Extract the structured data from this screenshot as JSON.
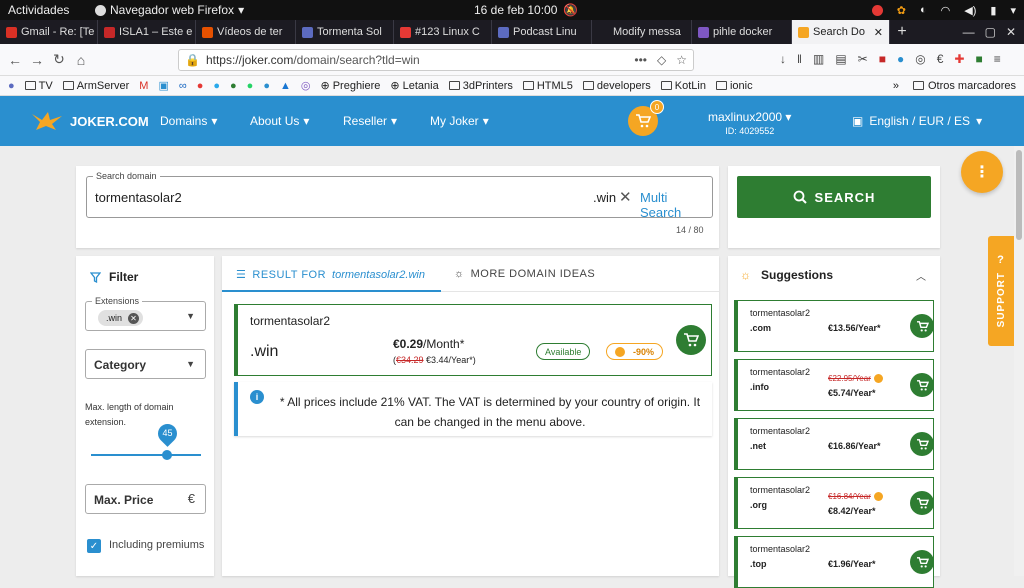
{
  "os": {
    "activities": "Actividades",
    "app_name": "Navegador web Firefox",
    "clock": "16 de feb  10:00"
  },
  "tabs": [
    {
      "label": "Gmail - Re: [Te",
      "color": "#d93025"
    },
    {
      "label": "ISLA1 – Este e",
      "color": "#c62828"
    },
    {
      "label": "Vídeos de ter",
      "color": "#e65100"
    },
    {
      "label": "Tormenta Sol",
      "color": "#5c6bc0"
    },
    {
      "label": "#123 Linux C",
      "color": "#e53935"
    },
    {
      "label": "Podcast Linu",
      "color": "#5c6bc0"
    },
    {
      "label": "Modify messa",
      "color": "#555555"
    },
    {
      "label": "pihle docker",
      "color": "#7e57c2"
    },
    {
      "label": "Search Do",
      "color": "#f5a623",
      "active": true
    }
  ],
  "url": {
    "host": "https://joker.com",
    "path": "/domain/search?tld=win"
  },
  "bookmarks": [
    "TV",
    "ArmServer",
    "Preghiere",
    "Letania",
    "3dPrinters",
    "HTML5",
    "developers",
    "KotLin",
    "ionic"
  ],
  "bookmarks_other": "Otros marcadores",
  "joker": {
    "logo": "JOKER.COM",
    "nav": [
      "Domains",
      "About Us",
      "Reseller",
      "My Joker"
    ],
    "cart_count": "0",
    "user": "maxlinux2000",
    "user_id": "ID: 4029552",
    "lang": "English / EUR / ES",
    "accent": "#2a8fcf",
    "orange": "#f5a623",
    "green": "#2e7d32"
  },
  "search": {
    "label": "Search domain",
    "value": "tormentasolar2",
    "tld": ".win",
    "multi": "Multi Search",
    "count": "14 / 80",
    "button": "SEARCH"
  },
  "support": "SUPPORT",
  "filter": {
    "title": "Filter",
    "ext_label": "Extensions",
    "ext_chip": ".win",
    "category": "Category",
    "maxlen_text": "Max. length of domain extension.",
    "maxlen_value": "45",
    "max_price": "Max. Price",
    "currency": "€",
    "premiums": "Including premiums"
  },
  "results": {
    "tab_result": "RESULT FOR",
    "tab_result_q": "tormentasolar2.win",
    "tab_ideas": "MORE DOMAIN IDEAS",
    "domain_name": "tormentasolar2",
    "domain_tld": ".win",
    "price": "€0.29",
    "period": "/Month*",
    "old_open": "(",
    "old_price": "€34.29",
    "year_price": " €3.44/Year",
    "old_close": "*)",
    "available": "Available",
    "discount": "-90%",
    "vat_star": "*",
    "vat": "All prices include 21% VAT. The VAT is determined by your country of origin. It can be changed in the menu above."
  },
  "suggestions": {
    "title": "Suggestions",
    "items": [
      {
        "name": "tormentasolar2",
        "tld": ".com",
        "price": "€13.56/Year*"
      },
      {
        "name": "tormentasolar2",
        "tld": ".info",
        "old": "€22.95/Year",
        "price": "€5.74/Year*"
      },
      {
        "name": "tormentasolar2",
        "tld": ".net",
        "price": "€16.86/Year*"
      },
      {
        "name": "tormentasolar2",
        "tld": ".org",
        "old": "€16.84/Year",
        "price": "€8.42/Year*"
      },
      {
        "name": "tormentasolar2",
        "tld": ".top",
        "price": "€1.96/Year*"
      }
    ]
  }
}
